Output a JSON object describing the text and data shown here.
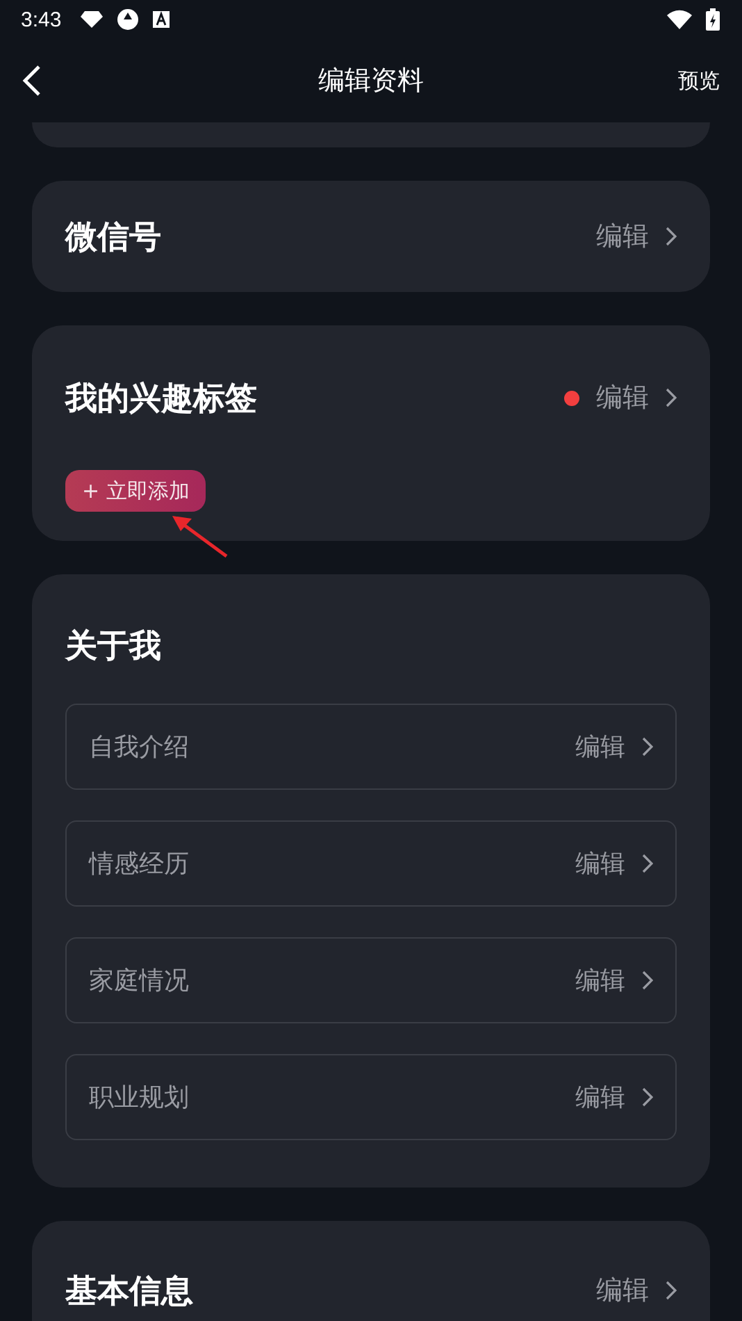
{
  "status_bar": {
    "time": "3:43"
  },
  "header": {
    "title": "编辑资料",
    "action": "预览"
  },
  "sections": [
    {
      "kind": "row",
      "title": "微信号",
      "action": "编辑",
      "dot": false
    },
    {
      "kind": "tags",
      "title": "我的兴趣标签",
      "action": "编辑",
      "dot": true,
      "add_button": "+ 立即添加",
      "annotation_arrow": true
    },
    {
      "kind": "list",
      "title": "关于我",
      "items": [
        {
          "label": "自我介绍",
          "action": "编辑"
        },
        {
          "label": "情感经历",
          "action": "编辑"
        },
        {
          "label": "家庭情况",
          "action": "编辑"
        },
        {
          "label": "职业规划",
          "action": "编辑"
        }
      ]
    },
    {
      "kind": "row",
      "title": "基本信息",
      "action": "编辑",
      "dot": false
    }
  ]
}
